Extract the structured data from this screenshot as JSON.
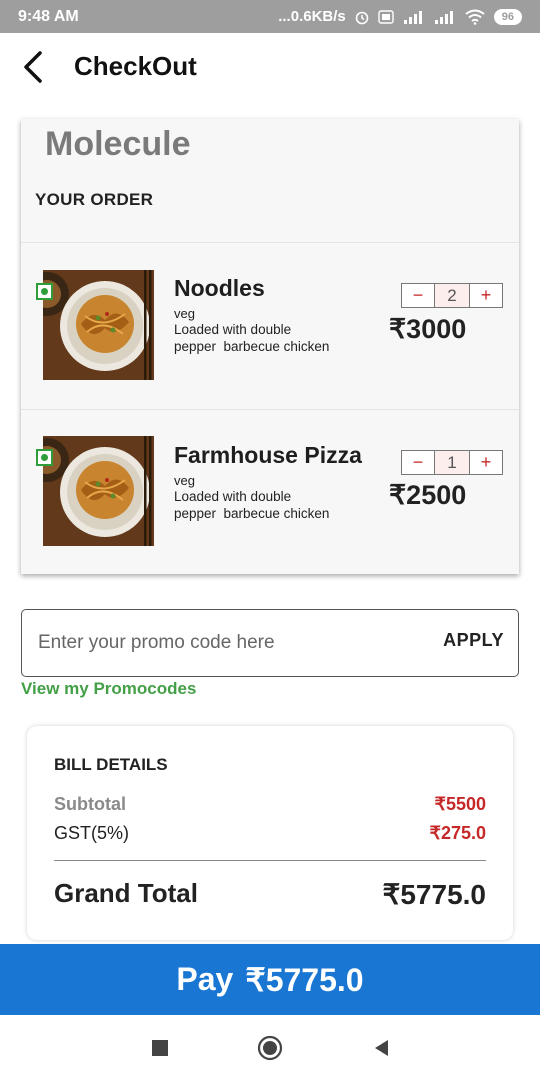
{
  "status_bar": {
    "time": "9:48 AM",
    "network_speed": "...0.6KB/s",
    "battery": "96",
    "icons": [
      "alarm-icon",
      "volte-icon",
      "signal-4g-icon",
      "signal-icon",
      "wifi-icon",
      "battery-icon"
    ]
  },
  "header": {
    "title": "CheckOut",
    "back_icon": "chevron-left-icon"
  },
  "order": {
    "restaurant": "Molecule",
    "section_title": "YOUR ORDER",
    "items": [
      {
        "name": "Noodles",
        "type": "veg",
        "description": "Loaded with double pepper  barbecue chicken",
        "quantity": "2",
        "price": "₹3000",
        "decrement": "−",
        "increment": "+"
      },
      {
        "name": "Farmhouse Pizza",
        "type": "veg",
        "description": "Loaded with double pepper  barbecue chicken",
        "quantity": "1",
        "price": "₹2500",
        "decrement": "−",
        "increment": "+"
      }
    ]
  },
  "promo": {
    "placeholder": "Enter your promo code here",
    "value": "",
    "apply_label": "APPLY",
    "view_link": "View my Promocodes"
  },
  "bill": {
    "title": "BILL DETAILS",
    "subtotal_label": "Subtotal",
    "subtotal_value": "₹5500",
    "gst_label": "GST(5%)",
    "gst_value": "₹275.0",
    "grand_label": "Grand Total",
    "grand_value": "₹5775.0"
  },
  "pay": {
    "label": "Pay",
    "amount": "₹5775.0"
  },
  "colors": {
    "accent": "#1976d2",
    "price_red": "#c62828",
    "link_green": "#43a047",
    "veg_green": "#2e9d3a"
  },
  "nav_bar": {
    "icons": [
      "recents-square-icon",
      "home-circle-icon",
      "back-triangle-icon"
    ]
  }
}
